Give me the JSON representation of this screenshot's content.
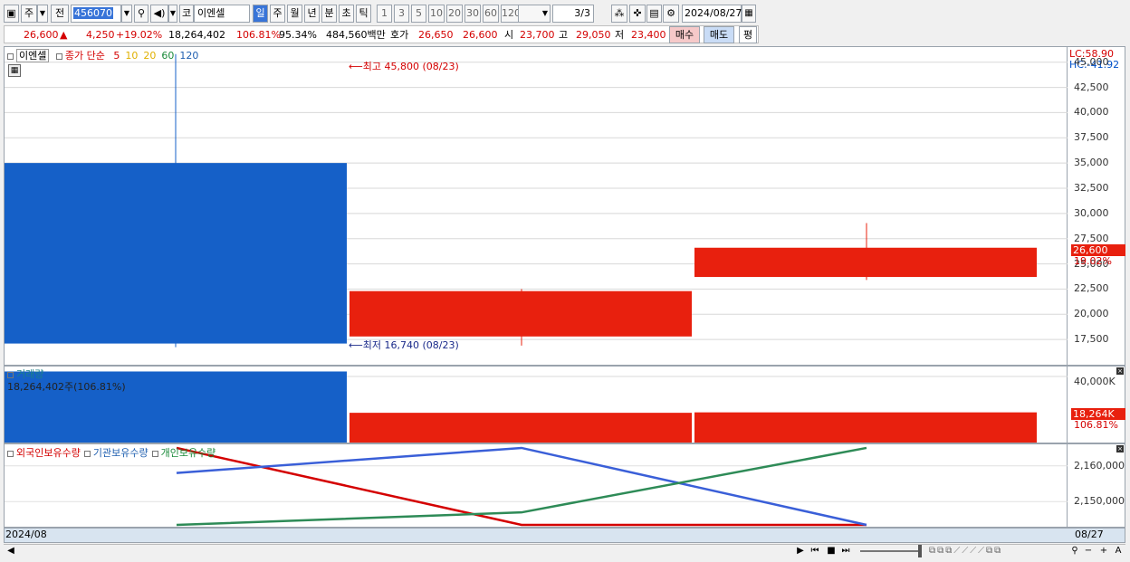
{
  "toolbar": {
    "period_btn": "주",
    "prev_btn": "전",
    "code": "456070",
    "market_tag": "코",
    "stock_name": "이엔셀",
    "period_tabs": [
      "일",
      "주",
      "월",
      "년",
      "분",
      "초",
      "틱"
    ],
    "interval_btns": [
      "1",
      "3",
      "5",
      "10",
      "20",
      "30",
      "60",
      "120"
    ],
    "page": "3/3",
    "date": "2024/08/27"
  },
  "quote": {
    "price": "26,600",
    "change": "4,250",
    "change_pct": "+19.02%",
    "volume": "18,264,402",
    "vol_ratio": "106.81%",
    "rate2": "95.34%",
    "amount": "484,560백만",
    "hoga_label": "호가",
    "ask": "26,650",
    "bid": "26,600",
    "open_label": "시",
    "open": "23,700",
    "high_label": "고",
    "high": "29,050",
    "low_label": "저",
    "low": "23,400",
    "buy_btn": "매수",
    "sell_btn": "매도",
    "eval_btn": "평"
  },
  "price_pane": {
    "legend_name": "이엔셀",
    "legend_ma": "종가 단순",
    "ma_periods": [
      "5",
      "10",
      "20",
      "60",
      "120"
    ],
    "ma_colors": [
      "#d40000",
      "#e0b000",
      "#e0b000",
      "#1a8a3a",
      "#1f5fb0"
    ],
    "high_marker": "최고 45,800 (08/23)",
    "low_marker": "최저 16,740 (08/23)",
    "lc": "LC:58.90",
    "hc": "HC:-41.92",
    "y_ticks": [
      "45,000",
      "42,500",
      "40,000",
      "37,500",
      "35,000",
      "32,500",
      "30,000",
      "27,500",
      "25,000",
      "22,500",
      "20,000",
      "17,500"
    ],
    "last_price_tag": "26,600",
    "last_pct_tag": "19.02%"
  },
  "volume_pane": {
    "title": "거래량",
    "value_text": "18,264,402주(106.81%)",
    "y_tick": "40,000K",
    "last_tag": "18,264K",
    "last_pct": "106.81%"
  },
  "holding_pane": {
    "legend": [
      "외국인보유수량",
      "기관보유수량",
      "개인보유수량"
    ],
    "legend_colors": [
      "#d40000",
      "#1f5fb0",
      "#1a8a3a"
    ],
    "y_ticks": [
      "2,160,000",
      "2,150,000"
    ]
  },
  "x_axis": {
    "left_label": "2024/08",
    "right_label": "08/27"
  },
  "chart_data": {
    "type": "candlestick",
    "y_range": [
      15000,
      46500
    ],
    "candles": [
      {
        "open": 35000,
        "close": 17100,
        "high": 45800,
        "low": 16740,
        "dir": "down"
      },
      {
        "open": 17800,
        "close": 22300,
        "high": 22500,
        "low": 16900,
        "dir": "up"
      },
      {
        "open": 23700,
        "close": 26600,
        "high": 29050,
        "low": 23400,
        "dir": "up"
      }
    ],
    "volume_range": [
      0,
      46000
    ],
    "volumes": [
      {
        "value": 43000,
        "dir": "down"
      },
      {
        "value": 18000,
        "dir": "up"
      },
      {
        "value": 18264,
        "dir": "up"
      }
    ],
    "holding_range": [
      2143000,
      2166000
    ],
    "holding_series": [
      {
        "name": "외국인보유수량",
        "color": "#d40000",
        "values": [
          2165000,
          2143500,
          2143500
        ]
      },
      {
        "name": "기관보유수량",
        "color": "#3a5fd8",
        "values": [
          2158000,
          2165000,
          2143500
        ]
      },
      {
        "name": "개인보유수량",
        "color": "#2e8b57",
        "values": [
          2143500,
          2147000,
          2165000
        ]
      }
    ]
  }
}
